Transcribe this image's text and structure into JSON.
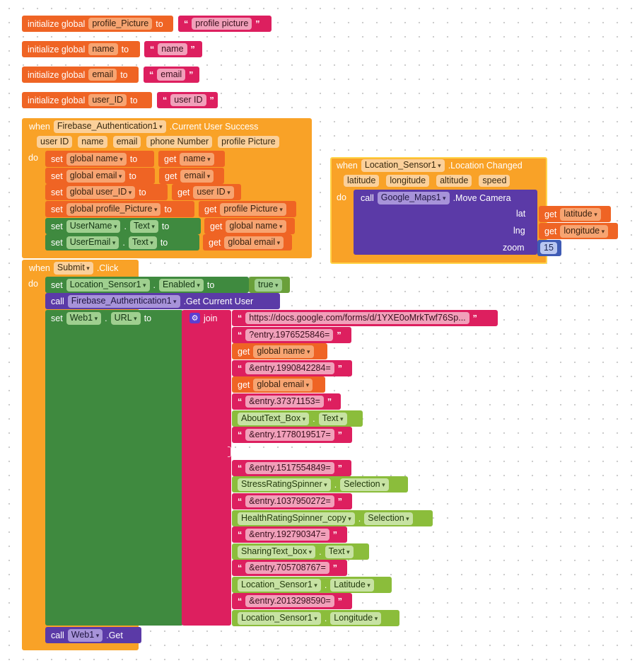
{
  "globals": [
    {
      "keyword": "initialize global",
      "name": "profile_Picture",
      "to": "to",
      "value": "profile picture"
    },
    {
      "keyword": "initialize global",
      "name": "name",
      "to": "to",
      "value": "name"
    },
    {
      "keyword": "initialize global",
      "name": "email",
      "to": "to",
      "value": "email"
    },
    {
      "keyword": "initialize global",
      "name": "user_ID",
      "to": "to",
      "value": "user ID"
    }
  ],
  "auth_event": {
    "when": "when",
    "component": "Firebase_Authentication1",
    "event": ".Current User Success",
    "params": [
      "user ID",
      "name",
      "email",
      "phone Number",
      "profile Picture"
    ],
    "do": "do",
    "statements": [
      {
        "set": "set",
        "target": "global name",
        "to": "to",
        "get": "get",
        "source": "name"
      },
      {
        "set": "set",
        "target": "global email",
        "to": "to",
        "get": "get",
        "source": "email"
      },
      {
        "set": "set",
        "target": "global user_ID",
        "to": "to",
        "get": "get",
        "source": "user ID"
      },
      {
        "set": "set",
        "target": "global profile_Picture",
        "to": "to",
        "get": "get",
        "source": "profile Picture"
      },
      {
        "set": "set",
        "component": "UserName",
        "dot": ".",
        "prop": "Text",
        "to": "to",
        "get": "get",
        "source": "global name"
      },
      {
        "set": "set",
        "component": "UserEmail",
        "dot": ".",
        "prop": "Text",
        "to": "to",
        "get": "get",
        "source": "global email"
      }
    ]
  },
  "location_event": {
    "when": "when",
    "component": "Location_Sensor1",
    "event": ".Location Changed",
    "params": [
      "latitude",
      "longitude",
      "altitude",
      "speed"
    ],
    "do": "do",
    "call": "call",
    "call_component": "Google_Maps1",
    "method": ".Move Camera",
    "args": [
      {
        "label": "lat",
        "get": "get",
        "value": "latitude"
      },
      {
        "label": "lng",
        "get": "get",
        "value": "longitude"
      },
      {
        "label": "zoom",
        "value": "15"
      }
    ]
  },
  "submit_event": {
    "when": "when",
    "component": "Submit",
    "event": ".Click",
    "do": "do",
    "set_location": {
      "set": "set",
      "component": "Location_Sensor1",
      "dot": ".",
      "prop": "Enabled",
      "to": "to",
      "value": "true"
    },
    "call_auth": {
      "call": "call",
      "component": "Firebase_Authentication1",
      "method": ".Get Current User"
    },
    "set_url": {
      "set": "set",
      "component": "Web1",
      "dot": ".",
      "prop": "URL",
      "to": "to",
      "join": "join"
    },
    "join_items": [
      {
        "kind": "text",
        "value": "https://docs.google.com/forms/d/1YXE0oMrkTwf76Sp..."
      },
      {
        "kind": "text",
        "value": "?entry.1976525846="
      },
      {
        "kind": "get",
        "get": "get",
        "value": "global name"
      },
      {
        "kind": "text",
        "value": "&entry.1990842284="
      },
      {
        "kind": "get",
        "get": "get",
        "value": "global email"
      },
      {
        "kind": "text",
        "value": "&entry.37371153="
      },
      {
        "kind": "prop",
        "component": "AboutText_Box",
        "dot": ".",
        "prop": "Text"
      },
      {
        "kind": "text",
        "value": "&entry.1778019517="
      },
      {
        "kind": "empty"
      },
      {
        "kind": "text",
        "value": "&entry.1517554849="
      },
      {
        "kind": "prop",
        "component": "StressRatingSpinner",
        "dot": ".",
        "prop": "Selection"
      },
      {
        "kind": "text",
        "value": "&entry.1037950272="
      },
      {
        "kind": "prop",
        "component": "HealthRatingSpinner_copy",
        "dot": ".",
        "prop": "Selection"
      },
      {
        "kind": "text",
        "value": "&entry.192790347="
      },
      {
        "kind": "prop",
        "component": "SharingText_box",
        "dot": ".",
        "prop": "Text"
      },
      {
        "kind": "text",
        "value": "&entry.705708767="
      },
      {
        "kind": "prop",
        "component": "Location_Sensor1",
        "dot": ".",
        "prop": "Latitude"
      },
      {
        "kind": "text",
        "value": "&entry.2013298590="
      },
      {
        "kind": "prop",
        "component": "Location_Sensor1",
        "dot": ".",
        "prop": "Longitude"
      }
    ],
    "call_web": {
      "call": "call",
      "component": "Web1",
      "method": ".Get"
    }
  },
  "colors": {
    "variables": "#ef6424",
    "text": "#dd1f5f",
    "events": "#f9a227",
    "components_set": "#3f8a3f",
    "components_get": "#8bbd3b",
    "procedures": "#5b3aa7"
  }
}
